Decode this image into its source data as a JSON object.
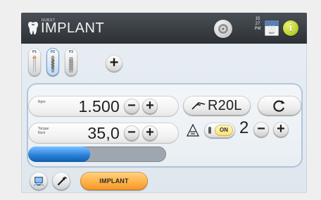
{
  "header": {
    "user": "GUEST",
    "title": "IMPLANT",
    "time": {
      "hour": "15",
      "minute": "27",
      "ampm": "PM"
    },
    "date": {
      "day": "28",
      "month": "MAY"
    },
    "info_label": "i"
  },
  "programs": {
    "items": [
      {
        "label": "P1",
        "selected": false
      },
      {
        "label": "P2",
        "selected": true
      },
      {
        "label": "P3",
        "selected": false
      }
    ],
    "add_label": "+"
  },
  "speed": {
    "label": "Rpm",
    "value": "1.500",
    "minus_label": "−",
    "plus_label": "+"
  },
  "torque": {
    "label_line1": "Torque",
    "label_line2": "Ncm",
    "value": "35,0",
    "minus_label": "−",
    "plus_label": "+",
    "progress_fraction": 0.45
  },
  "handpiece": {
    "mode": "R20L"
  },
  "light": {
    "status": "ON",
    "level": "2",
    "minus_label": "−",
    "plus_label": "+"
  },
  "bottom": {
    "tab_label": "IMPLANT"
  },
  "icons": {
    "brand": "implant-tooth-icon",
    "motor": "motor-icon",
    "calendar": "calendar-icon",
    "info": "info-icon",
    "handpiece": "handpiece-icon",
    "direction": "rotation-direction-icon",
    "light": "light-icon",
    "nav1": "screen-icon",
    "nav2": "wrench-icon"
  },
  "colors": {
    "top_bar": "#2d3136",
    "selected_blue": "#2a82db",
    "implant_orange": "#f2952a",
    "info_green": "#c3d73a",
    "on_yellow": "#ffe06f"
  }
}
